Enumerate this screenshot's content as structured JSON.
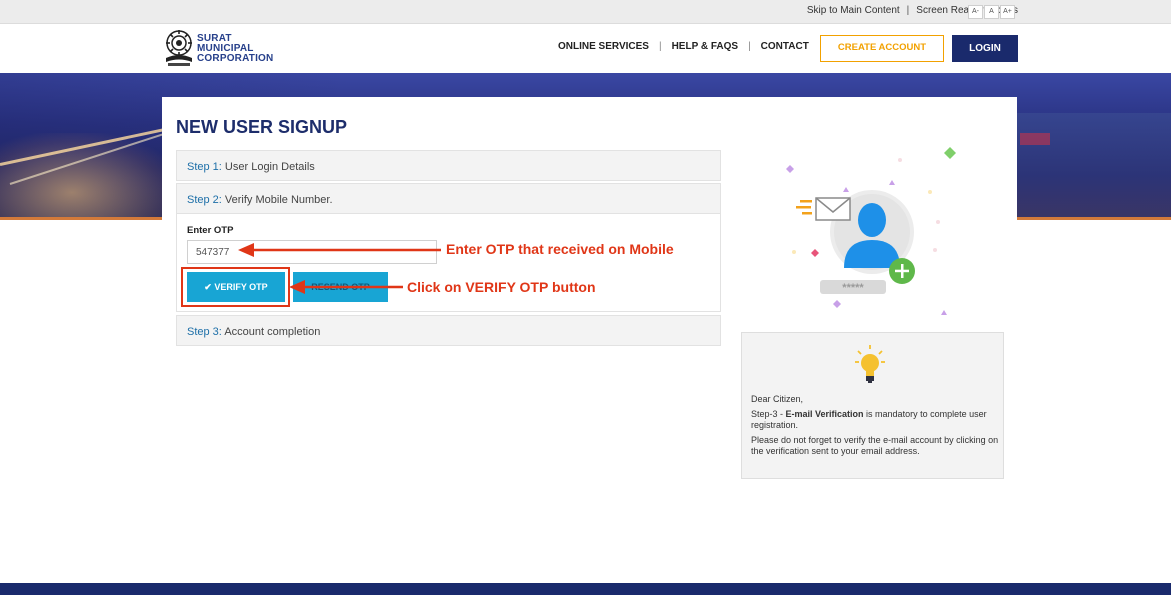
{
  "utility": {
    "skip_link": "Skip to Main Content",
    "screen_reader": "Screen Reader Access",
    "font_small": "A-",
    "font_normal": "A",
    "font_large": "A+"
  },
  "logo": {
    "line1": "SURAT",
    "line2": "MUNICIPAL",
    "line3": "CORPORATION"
  },
  "nav": {
    "online_services": "ONLINE SERVICES",
    "help": "HELP & FAQS",
    "contact": "CONTACT",
    "create_account": "CREATE ACCOUNT",
    "login": "LOGIN"
  },
  "signup": {
    "title": "NEW USER SIGNUP",
    "steps": [
      {
        "label": "Step 1:",
        "text": "User Login Details"
      },
      {
        "label": "Step 2:",
        "text": "Verify Mobile Number."
      },
      {
        "label": "Step 3:",
        "text": "Account completion"
      }
    ],
    "otp_label": "Enter OTP",
    "otp_value": "547377",
    "verify_button": "✔ VERIFY OTP",
    "resend_button": "RESEND OTP"
  },
  "annotations": {
    "enter_otp": "Enter OTP that received on Mobile",
    "click_verify": "Click on VERIFY OTP button"
  },
  "illustration": {
    "password_stars": "*****"
  },
  "info": {
    "greeting": "Dear Citizen,",
    "line1_prefix": "Step-3 - ",
    "line1_bold": "E-mail Verification",
    "line1_suffix": " is mandatory to complete user registration.",
    "line2": "Please do not forget to verify the e-mail account by clicking on the verification sent to your email address."
  },
  "colors": {
    "brand_navy": "#1a2a6c",
    "accent_orange": "#f2a100",
    "button_cyan": "#18a5d4",
    "annotation_red": "#e03617"
  }
}
